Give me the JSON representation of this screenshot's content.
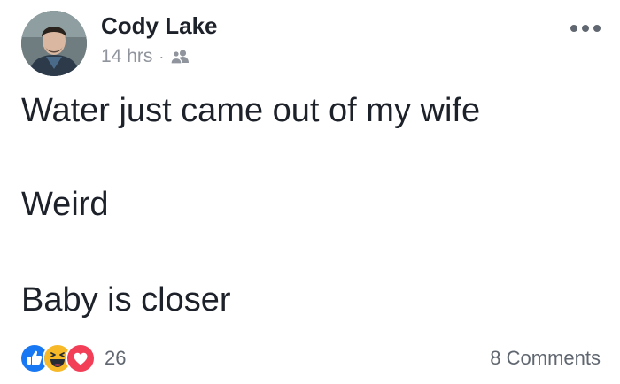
{
  "post": {
    "author_name": "Cody Lake",
    "timestamp": "14 hrs",
    "separator": "·",
    "audience_icon": "friends-icon",
    "more_icon": "more-options-icon",
    "lines": [
      "Water just came out of my wife",
      "Weird",
      "Baby is closer"
    ]
  },
  "footer": {
    "reaction_icons": [
      "like-reaction-icon",
      "haha-reaction-icon",
      "love-reaction-icon"
    ],
    "reaction_count": "26",
    "comments_label": "8 Comments"
  },
  "colors": {
    "text": "#1d2129",
    "secondary_text": "#90949c",
    "like_blue": "#1877f2",
    "haha_yellow": "#f7b928",
    "love_red": "#f33e58"
  }
}
